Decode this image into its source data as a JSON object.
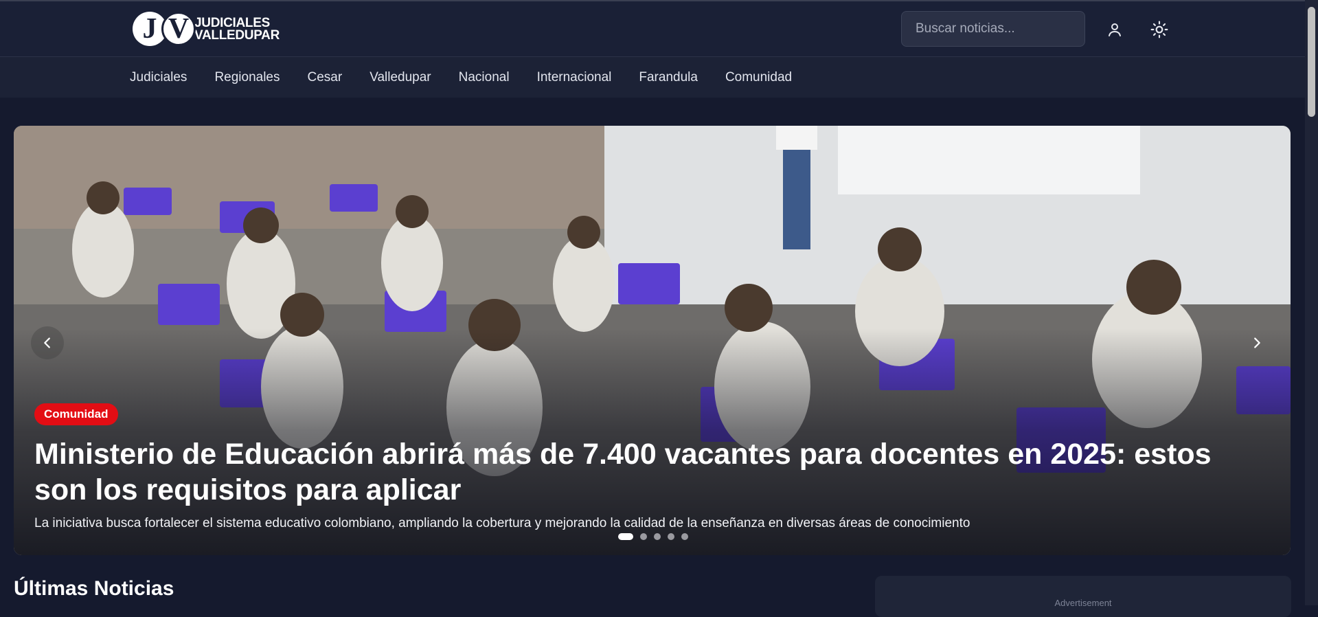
{
  "brand": {
    "mark_j": "J",
    "mark_v": "V",
    "line1": "JUDICIALES",
    "line2": "VALLEDUPAR"
  },
  "search": {
    "placeholder": "Buscar noticias..."
  },
  "header_icons": [
    "user-icon",
    "sun-icon"
  ],
  "nav": {
    "items": [
      "Judiciales",
      "Regionales",
      "Cesar",
      "Valledupar",
      "Nacional",
      "Internacional",
      "Farandula",
      "Comunidad"
    ]
  },
  "hero": {
    "category": "Comunidad",
    "title": "Ministerio de Educación abrirá más de 7.400 vacantes para docentes en 2025: estos son los requisitos para aplicar",
    "summary": "La iniciativa busca fortalecer el sistema educativo colombiano, ampliando la cobertura y mejorando la calidad de la enseñanza en diversas áreas de conocimiento",
    "slides_total": 5,
    "active_slide": 1,
    "colors": {
      "badge": "#e30d14"
    }
  },
  "latest": {
    "title": "Últimas Noticias"
  },
  "ad": {
    "label": "Advertisement"
  },
  "colors": {
    "background": "#151a2e",
    "topbar": "#1a2036",
    "navbar": "#1c2236"
  }
}
